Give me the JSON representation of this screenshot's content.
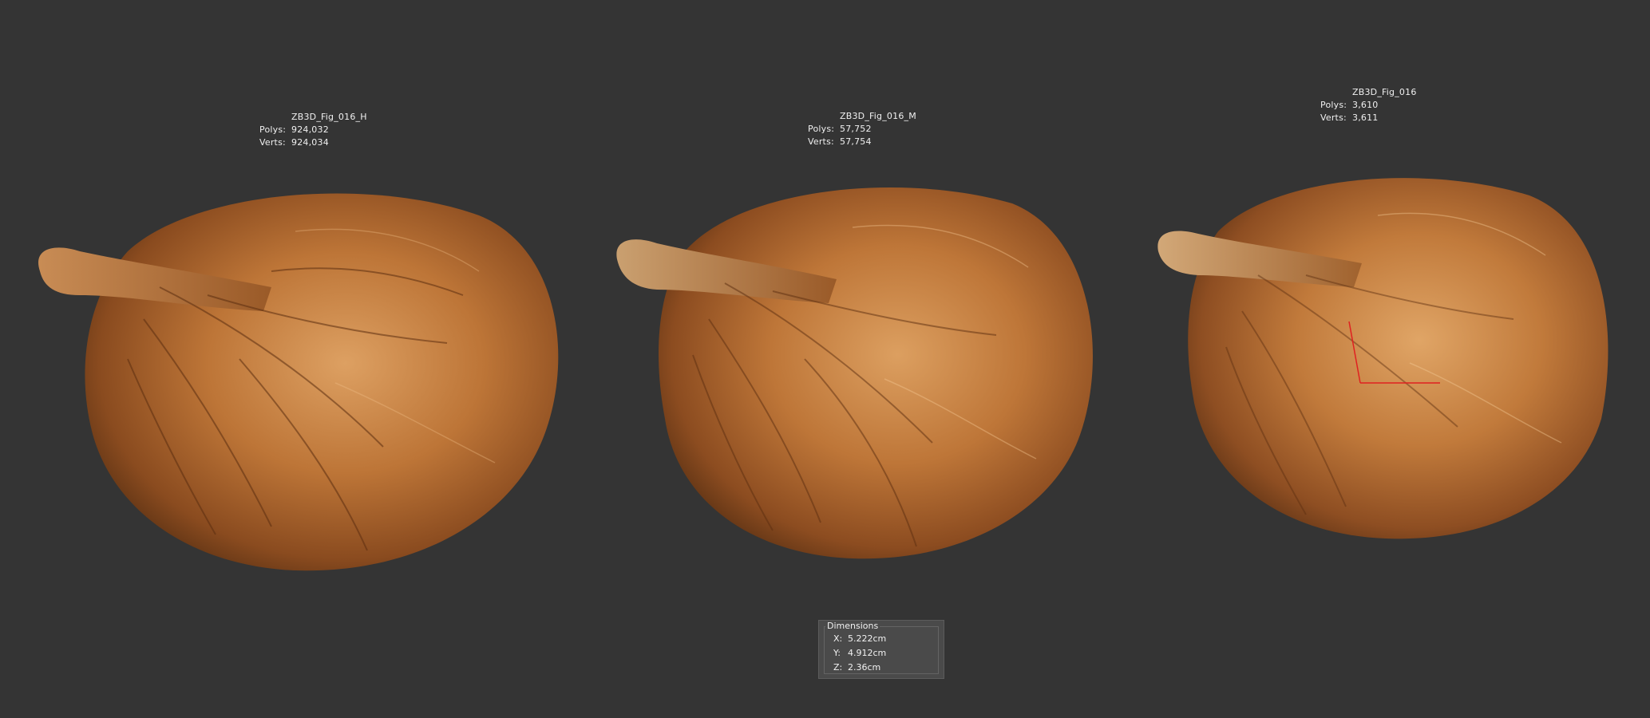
{
  "models": [
    {
      "name": "ZB3D_Fig_016_H",
      "polys_label": "Polys:",
      "polys": "924,032",
      "verts_label": "Verts:",
      "verts": "924,034"
    },
    {
      "name": "ZB3D_Fig_016_M",
      "polys_label": "Polys:",
      "polys": "57,752",
      "verts_label": "Verts:",
      "verts": "57,754"
    },
    {
      "name": "ZB3D_Fig_016",
      "polys_label": "Polys:",
      "polys": "3,610",
      "verts_label": "Verts:",
      "verts": "3,611"
    }
  ],
  "dimensions": {
    "title": "Dimensions",
    "x_label": "X:",
    "x": "5.222cm",
    "y_label": "Y:",
    "y": "4.912cm",
    "z_label": "Z:",
    "z": "2.36cm"
  },
  "colors": {
    "background": "#343434",
    "fig_light": "#d99a58",
    "fig_mid": "#b86f34",
    "fig_dark": "#6e3a17",
    "gizmo": "#e02020"
  }
}
